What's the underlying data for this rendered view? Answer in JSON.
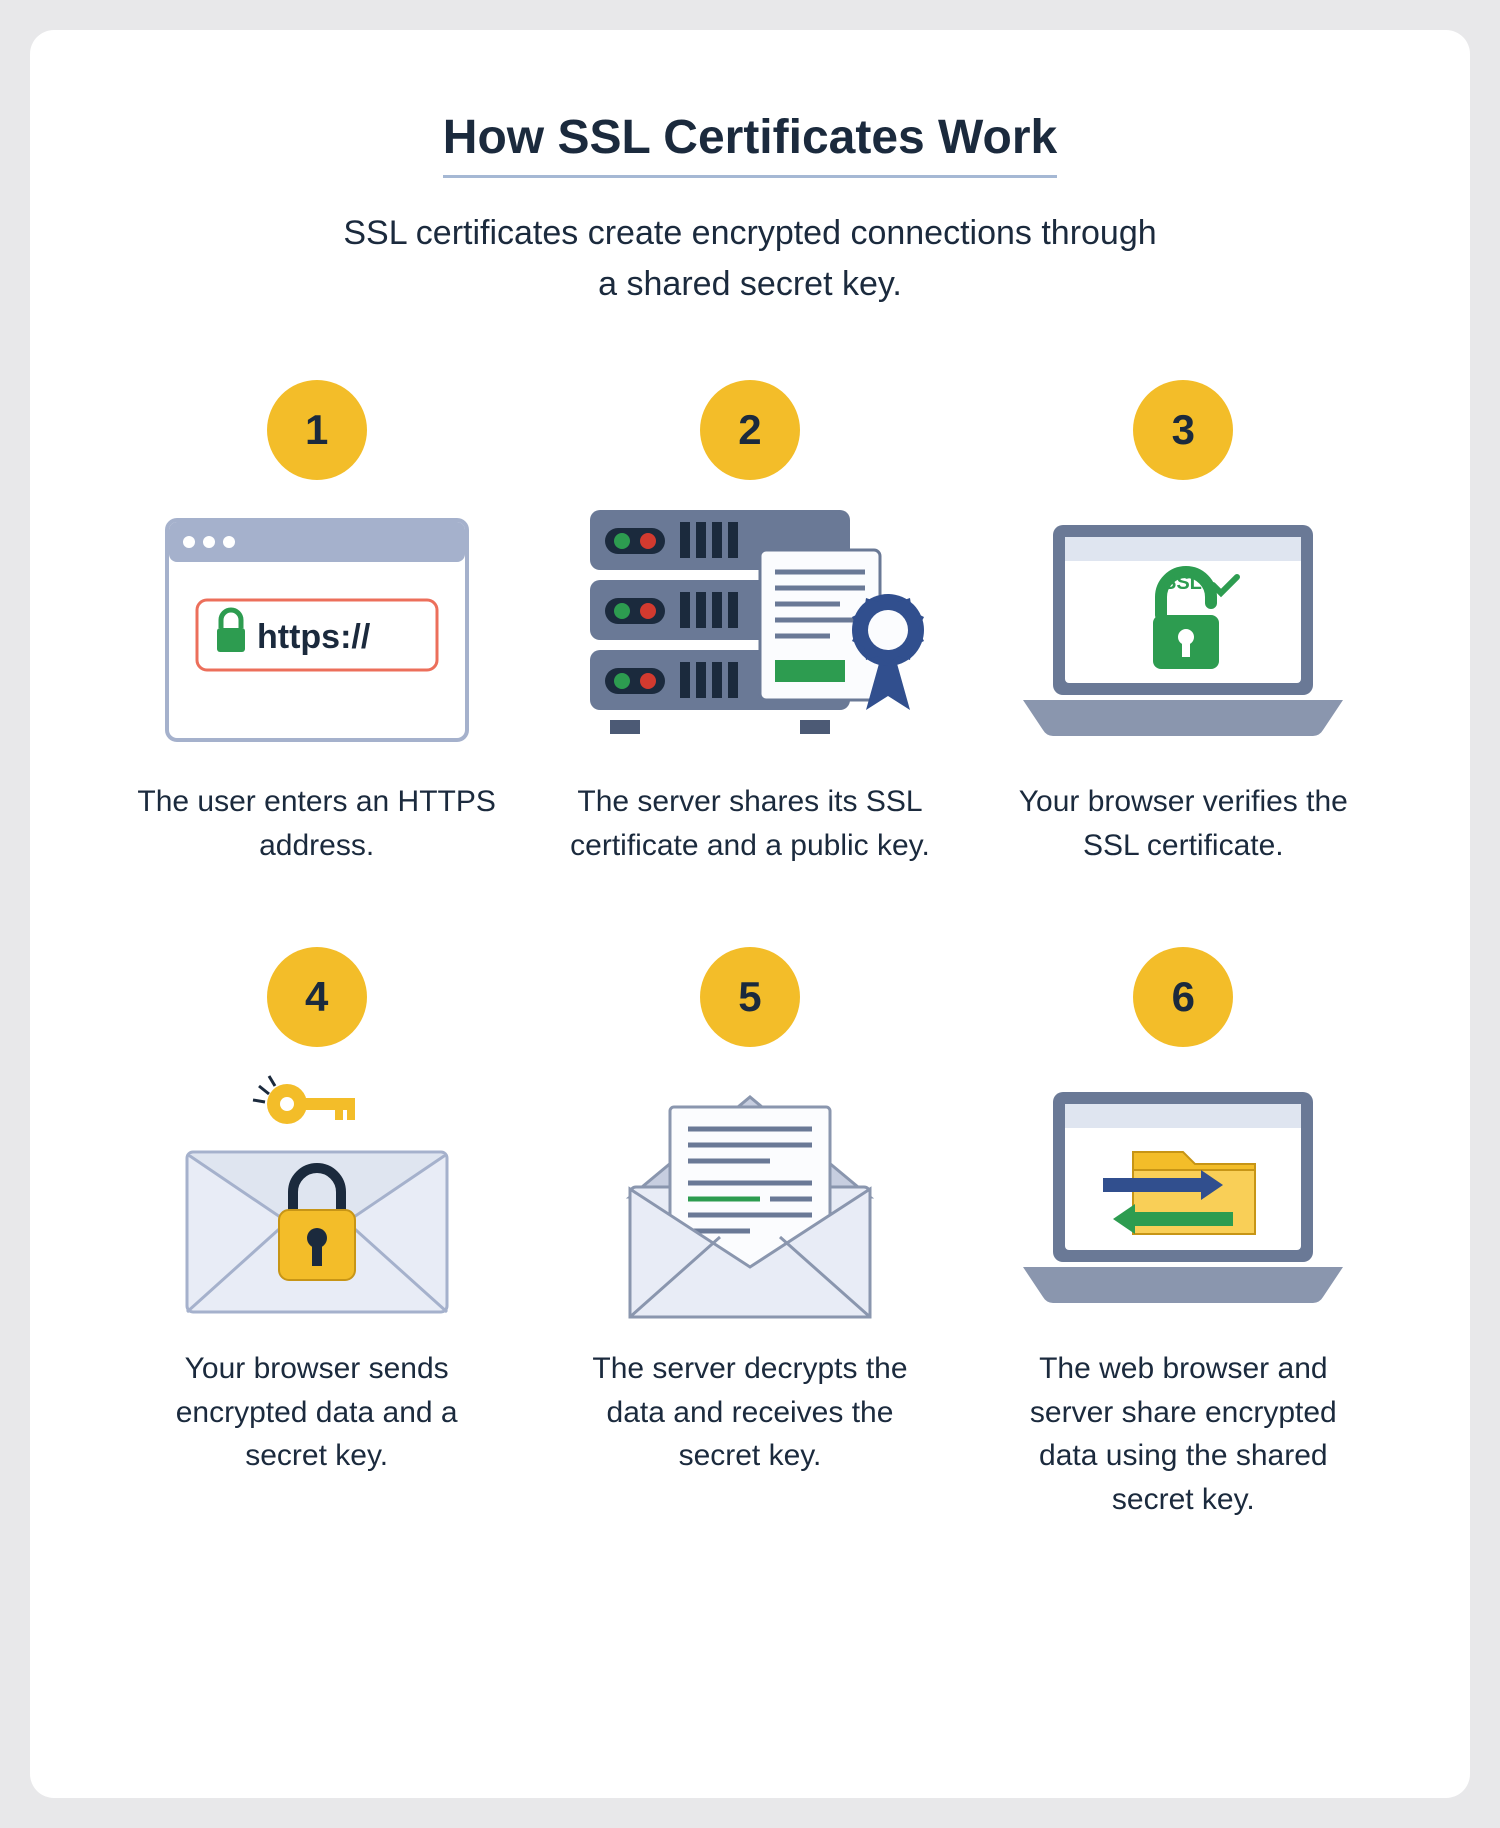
{
  "header": {
    "title": "How SSL Certificates Work",
    "subtitle": "SSL certificates create encrypted connections through a shared secret key."
  },
  "colors": {
    "accent": "#f3bd29",
    "text": "#1b2a3d",
    "green": "#2d9c50",
    "blue": "#314f8e",
    "slate": "#6a7996",
    "browser_bar": "#a5b1cc",
    "coral": "#ec6f5b",
    "ssl_label": "SSL"
  },
  "steps": [
    {
      "num": "1",
      "caption": "The user enters an HTTPS address.",
      "icon": "browser-https",
      "https_text": "https://"
    },
    {
      "num": "2",
      "caption": "The server shares its SSL certificate and a public key.",
      "icon": "server-certificate"
    },
    {
      "num": "3",
      "caption": "Your browser verifies the SSL certificate.",
      "icon": "laptop-ssl-lock",
      "ssl_text": "SSL"
    },
    {
      "num": "4",
      "caption": "Your browser sends encrypted data and a secret key.",
      "icon": "envelope-lock-key"
    },
    {
      "num": "5",
      "caption": "The server decrypts the data and receives the secret key.",
      "icon": "envelope-document"
    },
    {
      "num": "6",
      "caption": "The web browser and server share encrypted data using the shared secret key.",
      "icon": "laptop-folder-arrows"
    }
  ]
}
